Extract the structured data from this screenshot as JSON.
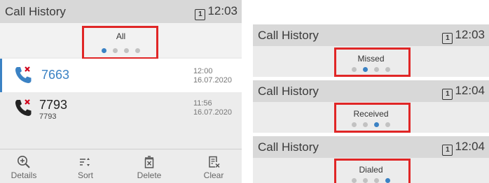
{
  "main_screen": {
    "title": "Call History",
    "line_badge": "1",
    "time": "12:03",
    "filter_label": "All",
    "entries": [
      {
        "number": "7663",
        "time": "12:00",
        "date": "16.07.2020"
      },
      {
        "number": "7793",
        "sub": "7793",
        "time": "11:56",
        "date": "16.07.2020"
      }
    ],
    "softkeys": [
      {
        "label": "Details",
        "icon": "zoom-in-icon"
      },
      {
        "label": "Sort",
        "icon": "sort-icon"
      },
      {
        "label": "Delete",
        "icon": "trash-icon"
      },
      {
        "label": "Clear",
        "icon": "clear-list-icon"
      }
    ]
  },
  "missed_screen": {
    "title": "Call History",
    "line_badge": "1",
    "time": "12:03",
    "filter_label": "Missed"
  },
  "received_screen": {
    "title": "Call History",
    "line_badge": "1",
    "time": "12:04",
    "filter_label": "Received"
  },
  "dialed_screen": {
    "title": "Call History",
    "line_badge": "1",
    "time": "12:04",
    "filter_label": "Dialed"
  },
  "colors": {
    "accent": "#3b82c4",
    "highlight": "#e02626",
    "missed": "#d0021b"
  }
}
